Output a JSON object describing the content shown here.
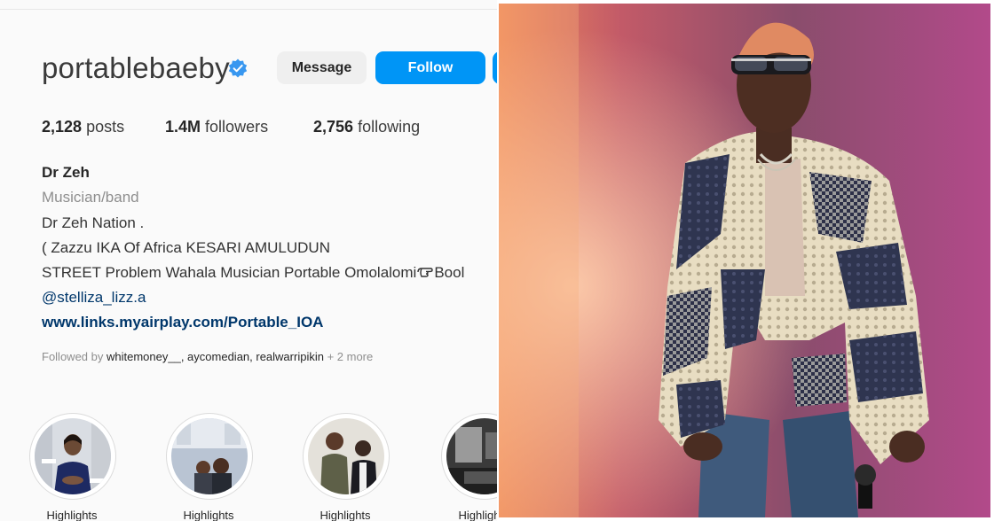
{
  "profile": {
    "username": "portablebaeby",
    "message_label": "Message",
    "follow_label": "Follow",
    "stats": {
      "posts_count": "2,128",
      "posts_label": "posts",
      "followers_count": "1.4M",
      "followers_label": "followers",
      "following_count": "2,756",
      "following_label": "following"
    },
    "bio": {
      "name": "Dr Zeh",
      "category": "Musician/band",
      "lines": [
        "Dr Zeh Nation .",
        "( Zazzu IKA Of Africa KESARI AMULUDUN",
        "STREET Problem Wahala Musician Portable Omolalomi",
        "@stelliza_lizz.a"
      ],
      "line3_suffix": "Bool",
      "link": "www.links.myairplay.com/Portable_IOA"
    },
    "followed_by": {
      "prefix": "Followed by",
      "names": "whitemoney__, aycomedian, realwarripikin",
      "more": "+ 2 more"
    },
    "highlights": [
      {
        "label": "Highlights",
        "icon": "woman-photo"
      },
      {
        "label": "Highlights",
        "icon": "children-photo"
      },
      {
        "label": "Highlights",
        "icon": "men-photo"
      },
      {
        "label": "Highlights",
        "icon": "dark-room-photo"
      }
    ]
  },
  "colors": {
    "follow_blue": "#0095f6",
    "verified_blue": "#3897f0",
    "link_blue": "#00376b"
  }
}
